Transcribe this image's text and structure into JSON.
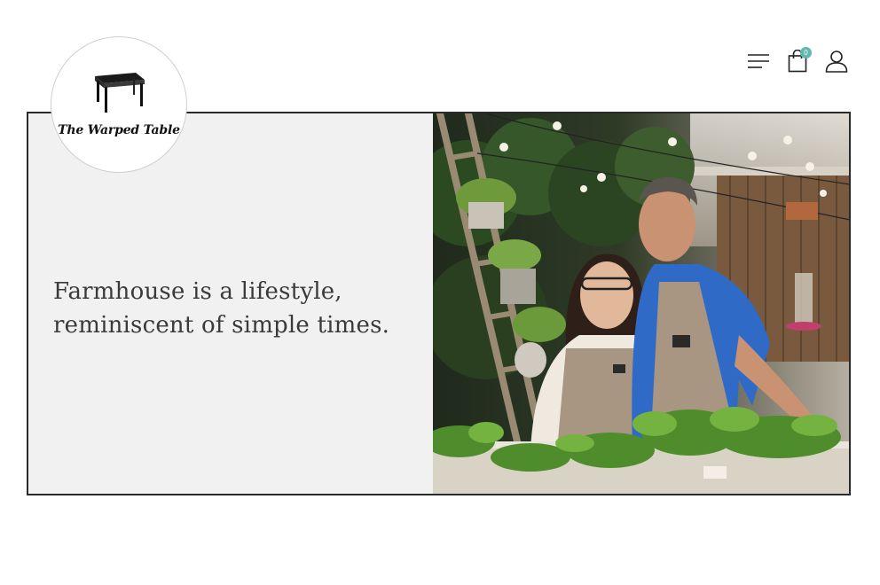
{
  "brand": {
    "name": "The Warped Table",
    "logo_icon": "table-icon"
  },
  "header": {
    "menu_icon": "menu-icon",
    "cart_icon": "shopping-bag-icon",
    "cart_count": "0",
    "account_icon": "user-icon",
    "accent_color": "#5fb8ac"
  },
  "hero": {
    "tagline": "Farmhouse is a lifestyle,\nreminiscent of simple times.",
    "image_alt_hint": "photo-couple-garden"
  }
}
